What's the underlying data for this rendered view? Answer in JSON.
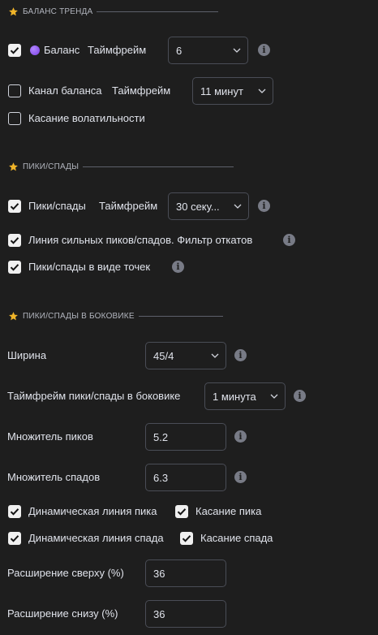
{
  "colors": {
    "background": "#1e1e1e",
    "text": "#e0e3eb",
    "muted": "#b2b5be",
    "star": "#f0b429",
    "info_icon": "#787b86",
    "border": "#4a4d56",
    "purple_dot": "#8e55f0"
  },
  "balance_trend": {
    "header": "БАЛАНС ТРЕНДА",
    "balance": {
      "checked": true,
      "label": "Баланс",
      "timeframe_label": "Таймфрейм",
      "timeframe_value": "6"
    },
    "balance_channel": {
      "checked": false,
      "label": "Канал баланса",
      "timeframe_label": "Таймфрейм",
      "timeframe_value": "11 минут"
    },
    "volatility_touch": {
      "checked": false,
      "label": "Касание волатильности"
    }
  },
  "peaks": {
    "header": "ПИКИ/СПАДЫ",
    "peaks_troughs": {
      "checked": true,
      "label": "Пики/спады",
      "timeframe_label": "Таймфрейм",
      "timeframe_value": "30 секу..."
    },
    "strong_line": {
      "checked": true,
      "label": "Линия сильных пиков/спадов. Фильтр откатов"
    },
    "dots": {
      "checked": true,
      "label": "Пики/спады в виде точек"
    }
  },
  "sideways": {
    "header": "ПИКИ/СПАДЫ В БОКОВИКЕ",
    "width": {
      "label": "Ширина",
      "value": "45/4"
    },
    "timeframe": {
      "label": "Таймфрейм пики/спады в боковике",
      "value": "1 минута"
    },
    "peak_multiplier": {
      "label": "Множитель пиков",
      "value": "5.2"
    },
    "trough_multiplier": {
      "label": "Множитель спадов",
      "value": "6.3"
    },
    "dynamic_peak_line": {
      "checked": true,
      "label": "Динамическая линия пика"
    },
    "peak_touch": {
      "checked": true,
      "label": "Касание пика"
    },
    "dynamic_trough_line": {
      "checked": true,
      "label": "Динамическая линия спада"
    },
    "trough_touch": {
      "checked": true,
      "label": "Касание спада"
    },
    "expand_top": {
      "label": "Расширение сверху (%)",
      "value": "36"
    },
    "expand_bottom": {
      "label": "Расширение снизу (%)",
      "value": "36"
    }
  }
}
